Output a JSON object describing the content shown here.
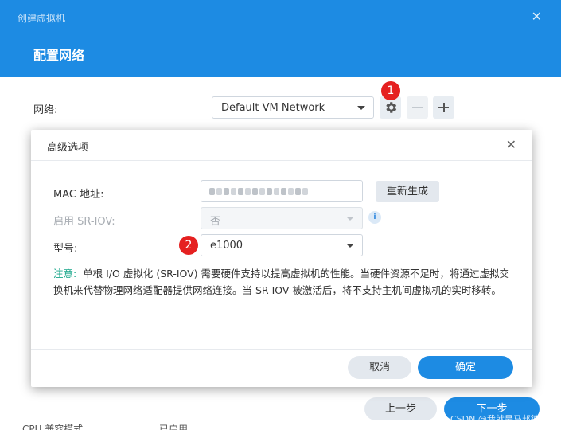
{
  "wizard": {
    "window_title": "创建虚拟机",
    "step_title": "配置网络",
    "network_label": "网络:",
    "network_value": "Default VM Network",
    "prev_label": "上一步",
    "next_label": "下一步",
    "below_row_label": "CPU 兼容模式",
    "below_row_value": "已启用"
  },
  "dialog": {
    "title": "高级选项",
    "mac_label": "MAC 地址:",
    "regenerate_label": "重新生成",
    "sriov_label": "启用 SR-IOV:",
    "sriov_value": "否",
    "model_label": "型号:",
    "model_value": "e1000",
    "note_prefix": "注意:",
    "note_text": "单根 I/O 虚拟化 (SR-IOV) 需要硬件支持以提高虚拟机的性能。当硬件资源不足时，将通过虚拟交换机来代替物理网络适配器提供网络连接。当 SR-IOV 被激活后，将不支持主机间虚拟机的实时移转。",
    "cancel_label": "取消",
    "ok_label": "确定"
  },
  "annotations": {
    "badge_1": "1",
    "badge_2": "2"
  },
  "watermark": "CSDN @我就是马邦德",
  "icons": {
    "close": "close-icon",
    "gear": "gear-icon",
    "minus": "minus-icon",
    "plus": "plus-icon",
    "info": "info-icon"
  },
  "colors": {
    "accent": "#1d8be3",
    "badge": "#e52020",
    "note_prefix": "#19a68a"
  }
}
